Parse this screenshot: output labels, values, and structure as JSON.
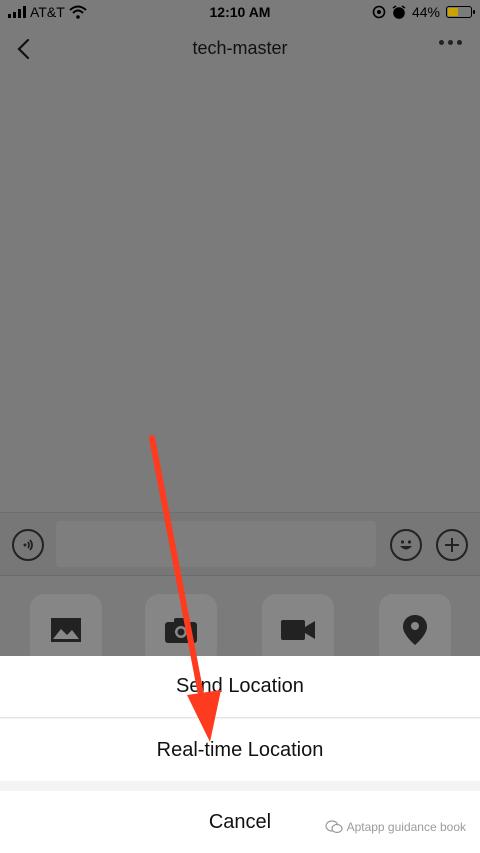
{
  "status_bar": {
    "carrier": "AT&T",
    "time": "12:10 AM",
    "battery_percent": "44%",
    "battery_level": 0.44,
    "icons": [
      "signal-icon",
      "wifi-icon",
      "location-lock-icon",
      "alarm-icon",
      "battery-icon"
    ]
  },
  "nav": {
    "title": "tech-master",
    "back_icon": "chevron-left-icon",
    "more_icon": "more-dots-icon"
  },
  "input_bar": {
    "voice_icon": "voice-icon",
    "emoji_icon": "emoji-icon",
    "plus_icon": "plus-icon",
    "text_value": ""
  },
  "tools": [
    {
      "icon": "image-icon"
    },
    {
      "icon": "camera-icon"
    },
    {
      "icon": "video-icon"
    },
    {
      "icon": "location-pin-icon"
    }
  ],
  "action_sheet": {
    "send_location": "Send Location",
    "realtime_location": "Real-time Location",
    "cancel": "Cancel"
  },
  "watermark": "Aptapp guidance book",
  "colors": {
    "overlay": "#7b7b7b",
    "sheet_bg": "#ffffff",
    "arrow": "#ff3b1f",
    "battery_fill": "#caa300"
  }
}
